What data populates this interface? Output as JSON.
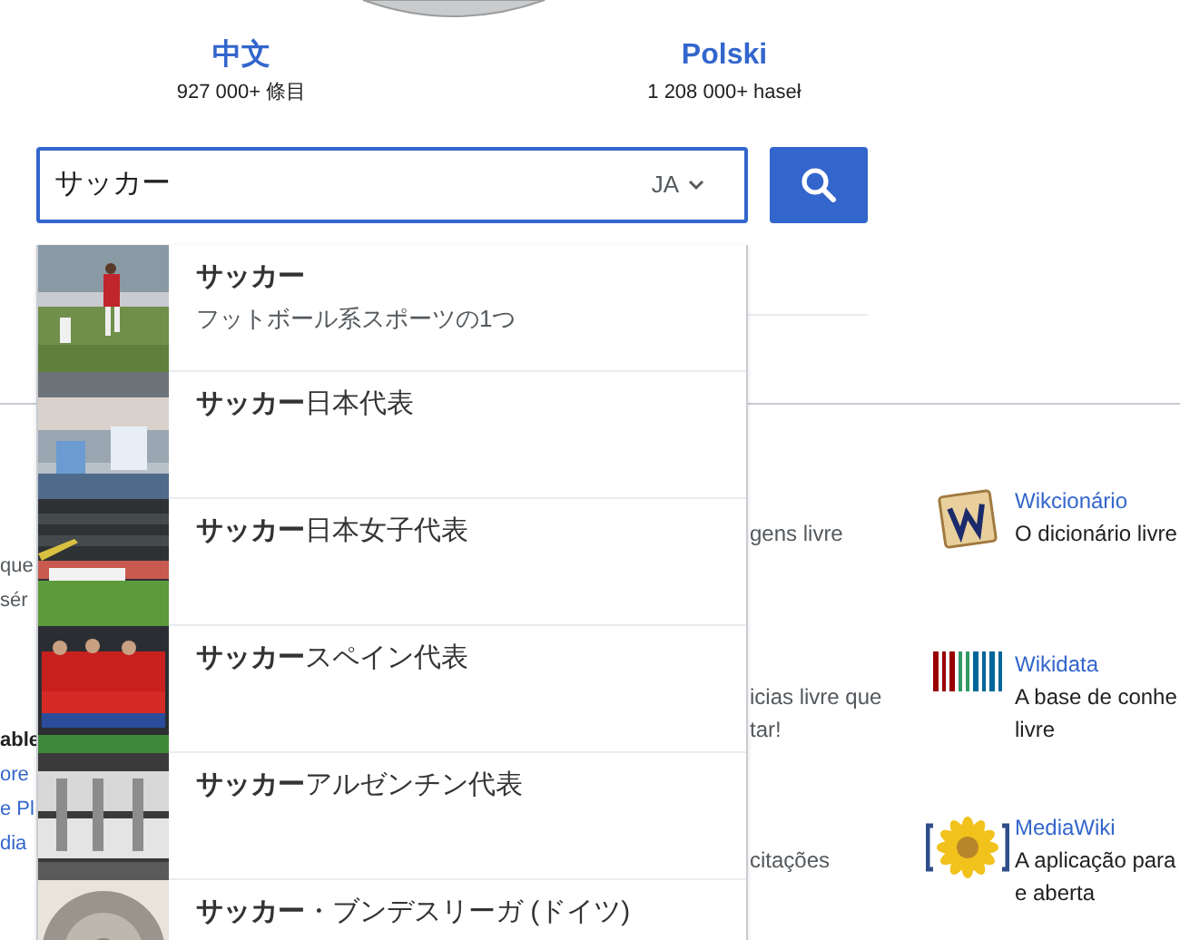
{
  "languages": [
    {
      "name": "中文",
      "count": "927 000+ 條目"
    },
    {
      "name": "Polski",
      "count": "1 208 000+ haseł"
    }
  ],
  "search": {
    "value": "サッカー",
    "language": "JA"
  },
  "suggestions": [
    {
      "title": "**サッカー**",
      "description": "フットボール系スポーツの1つ",
      "kind": "picture"
    },
    {
      "title": "**サッカー**日本代表",
      "kind": "picture"
    },
    {
      "title": "**サッカー**日本女子代表",
      "kind": "picture"
    },
    {
      "title": "**サッカー**スペイン代表",
      "kind": "picture"
    },
    {
      "title": "**サッカー**アルゼンチン代表",
      "kind": "picture"
    },
    {
      "title": "**サッカー**・ブンデスリーガ (ドイツ)",
      "kind": "picture"
    }
  ],
  "left_fragments": [
    {
      "text": "que",
      "kind": "text"
    },
    {
      "text": "sér",
      "kind": "text"
    },
    {
      "text": "able",
      "kind": "heading"
    },
    {
      "text": "ore",
      "kind": "link"
    },
    {
      "text": "e Pl",
      "kind": "link"
    },
    {
      "text": "dia",
      "kind": "link"
    }
  ],
  "middle_fragments": [
    [
      "gens livre"
    ],
    [
      "icias livre que",
      "tar!"
    ],
    [
      "citações"
    ]
  ],
  "projects": [
    {
      "name": "Wikcionário",
      "description": [
        "O dicionário livre"
      ],
      "kind": "tile"
    },
    {
      "name": "Wikidata",
      "description": [
        "A base de conhe",
        "livre"
      ],
      "kind": "barcode"
    },
    {
      "name": "MediaWiki",
      "description": [
        "A aplicação para",
        "e aberta"
      ],
      "kind": "flower"
    }
  ]
}
